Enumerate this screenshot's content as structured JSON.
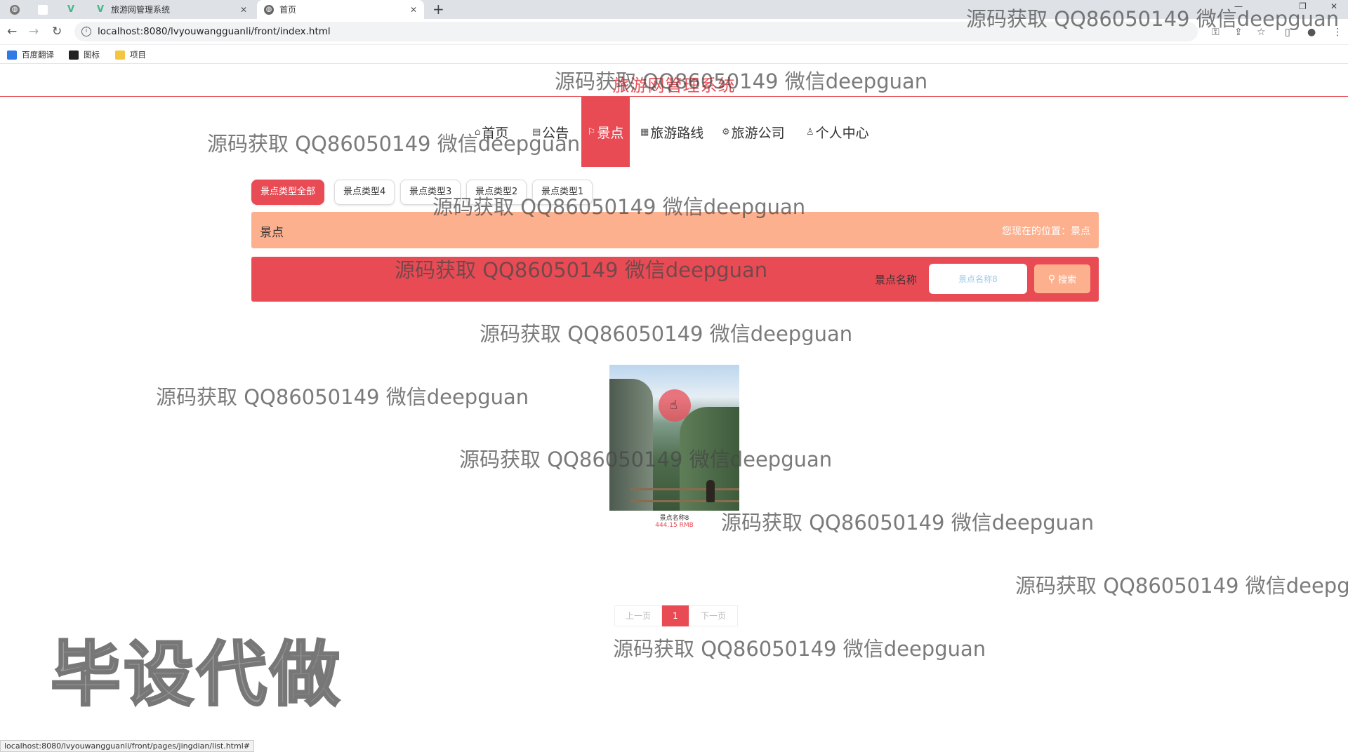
{
  "browser": {
    "tabs": [
      {
        "title": "",
        "icon": "globe-icon"
      },
      {
        "title": "",
        "icon": "blank-tab-icon"
      },
      {
        "title": "",
        "icon": "vue-logo-icon"
      },
      {
        "title": "旅游网管理系统",
        "icon": "vue-logo-icon"
      },
      {
        "title": "首页",
        "icon": "globe-icon"
      }
    ],
    "url": "localhost:8080/lvyouwangguanli/front/index.html",
    "bookmarks": [
      {
        "label": "百度翻译",
        "icon": "translate-icon",
        "color": "#2f7ae5"
      },
      {
        "label": "图标",
        "icon": "image-icon",
        "color": "#222222"
      },
      {
        "label": "项目",
        "icon": "folder-icon",
        "color": "#f4c542"
      }
    ],
    "status_url": "localhost:8080/lvyouwangguanli/front/pages/jingdian/list.html#"
  },
  "site": {
    "title": "旅游网管理系统",
    "nav": [
      {
        "label": "首页",
        "icon": "home-icon",
        "active": false
      },
      {
        "label": "公告",
        "icon": "notice-icon",
        "active": false
      },
      {
        "label": "景点",
        "icon": "flag-icon",
        "active": true
      },
      {
        "label": "旅游路线",
        "icon": "grid-icon",
        "active": false
      },
      {
        "label": "旅游公司",
        "icon": "gear-icon",
        "active": false
      },
      {
        "label": "个人中心",
        "icon": "user-icon",
        "active": false
      }
    ]
  },
  "types": [
    "景点类型全部",
    "景点类型4",
    "景点类型3",
    "景点类型2",
    "景点类型1"
  ],
  "breadcrumb": {
    "title": "景点",
    "location": "您现在的位置：景点"
  },
  "search": {
    "label": "景点名称",
    "value": "景点名称8",
    "button": "搜索"
  },
  "items": [
    {
      "name": "景点名称8",
      "price": "444.15 RMB"
    }
  ],
  "pager": {
    "prev": "上一页",
    "current": "1",
    "next": "下一页"
  },
  "watermark": {
    "text": "源码获取 QQ86050149 微信deepguan",
    "big": "毕设代做"
  },
  "colors": {
    "accent": "#e94b55",
    "peach": "#fdb08e"
  }
}
